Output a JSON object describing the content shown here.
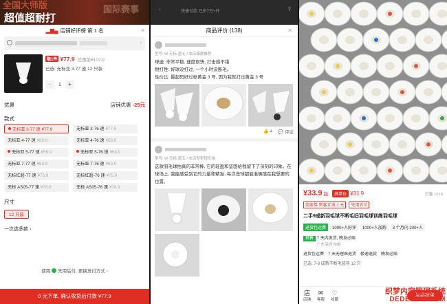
{
  "left": {
    "banner_top": "全国大师版",
    "banner_main": "超值超耐打",
    "banner_right": "国际赛事",
    "rank": "店铺好评榜 第 1 名",
    "product": {
      "tag": "限1件",
      "price": "¥77.9",
      "orig": "优惠前¥102.9",
      "selected": "已选: 无标亚 3-77 速 12 只装",
      "qty": "1"
    },
    "discount_label": "优惠",
    "discount_value_prefix": "店铺优惠",
    "discount_value": "-25元",
    "style_title": "款式",
    "chips": [
      {
        "name": "无标亚 3-77 速",
        "price": "¥77.9",
        "active": true,
        "dot": true
      },
      {
        "name": "无标亚 3-76 速",
        "price": "¥77.9",
        "active": false,
        "dot": false
      },
      {
        "name": "无标亚 4-77 速",
        "price": "¥69.9",
        "active": false,
        "dot": false
      },
      {
        "name": "无标亚 4-76 速",
        "price": "¥69.9",
        "active": false,
        "dot": false
      },
      {
        "name": "无标亚 5-77 速",
        "price": "¥58.9",
        "active": false,
        "dot": true
      },
      {
        "name": "无标亚 5-76 速",
        "price": "¥58.9",
        "active": false,
        "dot": true
      },
      {
        "name": "无标亚 7-77 速",
        "price": "¥63.9",
        "active": false,
        "dot": false
      },
      {
        "name": "无标亚 7-76 速",
        "price": "¥63.9",
        "active": false,
        "dot": false
      },
      {
        "name": "无标红超-77 速",
        "price": "¥75.9",
        "active": false,
        "dot": false
      },
      {
        "name": "无标红超-76 速",
        "price": "¥75.9",
        "active": false,
        "dot": false
      },
      {
        "name": "无标 AS05-77 速",
        "price": "¥78.9",
        "active": false,
        "dot": false
      },
      {
        "name": "无标 AS05-76 速",
        "price": "¥78.9",
        "active": false,
        "dot": false
      }
    ],
    "size_title": "尺寸",
    "size_value": "12 只装",
    "buy_more": "一次选多款",
    "pay_text": "使用",
    "pay_method": "先用后付",
    "pay_change": ", 更换支付方式",
    "cta": "0 元下单, 确认收货后付款 ¥77.9"
  },
  "mid": {
    "top_title": "快捷付款 已拼7万+件",
    "header": "商品评价 (138)",
    "reviews": [
      {
        "meta": "型号: W-无标-蓝七 / 本店爆款推荐",
        "lines": [
          "球速: 非常平稳, 速度很快, 打击感不错",
          "耐打性: 好球没打过, 一个小时没断毛。",
          "性价比: 最起码好过标黄金 3 号, 因为我就打过黄金 3 号"
        ],
        "likes": "4",
        "comment": "评论"
      },
      {
        "meta": "型号: W-无标-蓝五 / 本店型型规乐球",
        "lines": [
          "这款羽毛球拍真的非常棒, 它的轻盈和坚固给我留下了深刻的印象。在球场上, 我能感受到它的力量和精准, 每次击球都能准确落在我想要的位置。"
        ]
      }
    ]
  },
  "right": {
    "price_currency": "¥",
    "price": "33.9",
    "price_suffix": "起",
    "group_label": "拼单价",
    "group_price": "¥31.9",
    "sold": "已售 1616",
    "badges": [
      "商家券 新客立减 2 元",
      "先用后付"
    ],
    "title": "二手9成新羽毛球不断毛旧羽毛球训练羽毛球",
    "info": [
      {
        "text": "退货包运费",
        "green": true
      },
      {
        "text": "1000+人好评",
        "green": false
      },
      {
        "text": "1000+人加购",
        "green": false
      },
      {
        "text": "3 个月内 200+人",
        "green": false
      }
    ],
    "presale_label": "预售",
    "presale_text": "7 天内发货, 晚发必赔",
    "presale_sub": "广东深圳  包邮",
    "guarantees": [
      "退货包运费",
      "7 天无理由退货",
      "极速退款",
      "晚发必赔"
    ],
    "note": "已选: 7-8 成新不断毛蓝羽 12 只",
    "foot": [
      {
        "icon": "店",
        "label": "店铺"
      },
      {
        "icon": "✉",
        "label": "客服"
      },
      {
        "icon": "♡",
        "label": "收藏"
      }
    ],
    "buy_btn": "发起拼单",
    "watermark_1": "织梦内容管理系统",
    "watermark_2": "DEDECMS.COM"
  }
}
